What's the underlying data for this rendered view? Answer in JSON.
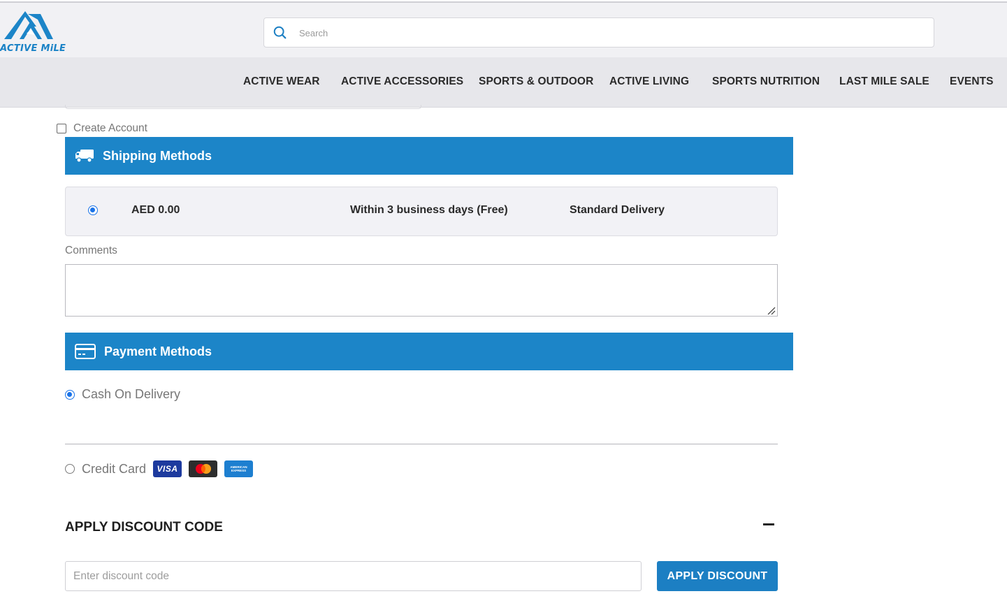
{
  "header": {
    "logo_text": "ACTIVE MiLE",
    "search_placeholder": "Search"
  },
  "nav": {
    "items": [
      {
        "label": "ACTIVE WEAR"
      },
      {
        "label": "ACTIVE ACCESSORIES"
      },
      {
        "label": "SPORTS & OUTDOOR"
      },
      {
        "label": "ACTIVE LIVING"
      },
      {
        "label": "SPORTS NUTRITION"
      },
      {
        "label": "LAST MILE SALE"
      },
      {
        "label": "EVENTS"
      }
    ]
  },
  "checkout": {
    "create_account_label": "Create Account",
    "create_account_checked": false,
    "shipping": {
      "title": "Shipping Methods",
      "icon": "truck-icon",
      "option": {
        "price": "AED 0.00",
        "time": "Within 3 business days (Free)",
        "name": "Standard Delivery",
        "selected": true
      }
    },
    "comments": {
      "label": "Comments",
      "value": ""
    },
    "payment": {
      "title": "Payment Methods",
      "icon": "credit-card-icon",
      "options": [
        {
          "label": "Cash On Delivery",
          "selected": true
        },
        {
          "label": "Credit Card",
          "selected": false,
          "cards": [
            "visa",
            "mastercard",
            "amex"
          ],
          "visa_text": "VISA",
          "amex_text": "AMERICAN EXPRESS"
        }
      ]
    },
    "discount": {
      "title": "APPLY DISCOUNT CODE",
      "placeholder": "Enter discount code",
      "button_label": "APPLY DISCOUNT"
    }
  },
  "colors": {
    "brand_blue": "#1c85c8",
    "radio_blue": "#1a73e8",
    "nav_bg": "#e7e7eb"
  }
}
